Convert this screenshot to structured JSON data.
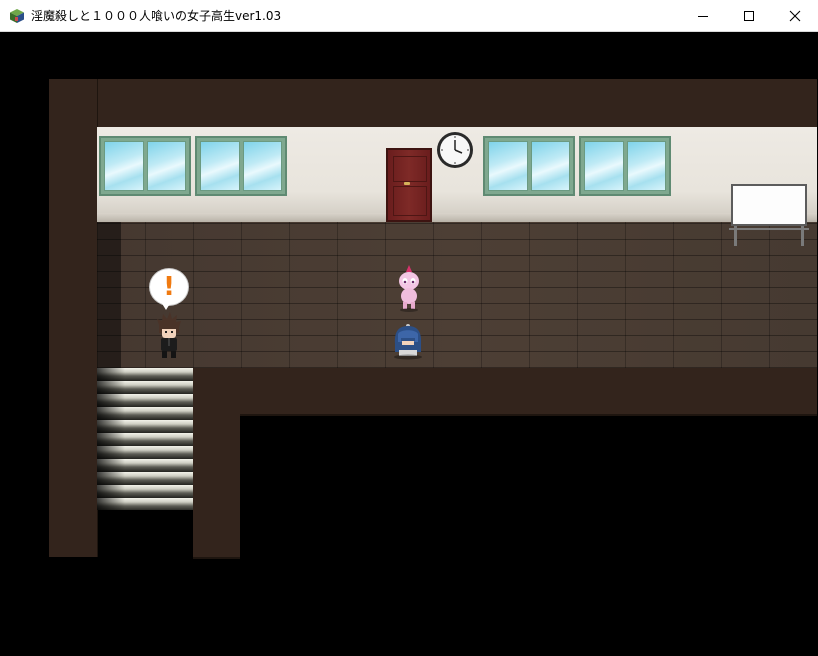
{
  "window": {
    "title": "淫魔殺しと１０００人喰いの女子高生ver1.03",
    "icon": "game-cube-icon",
    "controls": [
      "minimize-icon",
      "maximize-icon",
      "close-icon"
    ]
  },
  "scene": {
    "type": "rpg-map",
    "location_elements": [
      "school-hallway",
      "windows",
      "door",
      "wall-clock",
      "whiteboard",
      "staircase"
    ],
    "characters": [
      {
        "name": "schoolboy-player",
        "emote": "!"
      },
      {
        "name": "pink-demon-creature"
      },
      {
        "name": "blue-haired-schoolgirl"
      }
    ],
    "colors": {
      "wall_dark": "#33241c",
      "floor": "#4a3c32",
      "door": "#7e2a27",
      "window_glass": "#7fd3ea",
      "exclamation": "#f07a10"
    }
  }
}
